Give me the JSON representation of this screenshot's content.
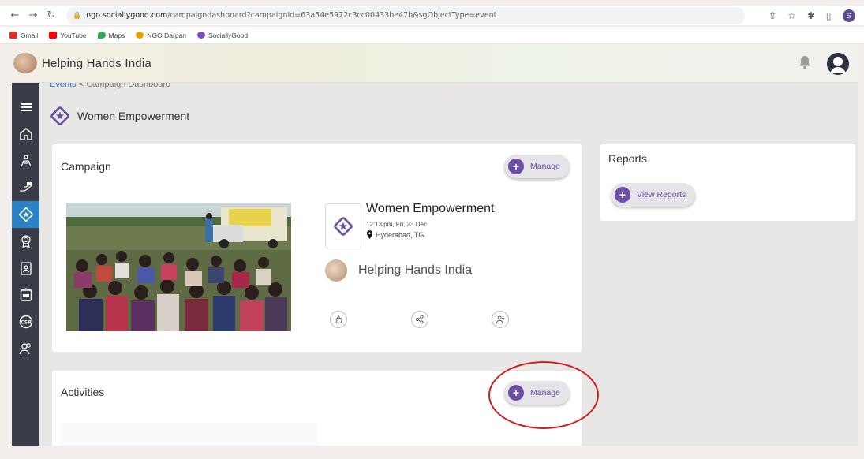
{
  "browser": {
    "url_host": "ngo.sociallygood.com",
    "url_rest": "/campaigndashboard?campaignId=63a54e5972c3cc00433be47b&sgObjectType=event",
    "profile_initial": "S",
    "bookmarks": [
      {
        "label": "Gmail",
        "color": "#d93025"
      },
      {
        "label": "YouTube",
        "color": "#ff0000"
      },
      {
        "label": "Maps",
        "color": "#34a853"
      },
      {
        "label": "NGO Darpan",
        "color": "#e8a200"
      },
      {
        "label": "SociallyGood",
        "color": "#7b4fc9"
      }
    ]
  },
  "header": {
    "org_name": "Helping Hands India"
  },
  "breadcrumb": {
    "link": "Events",
    "separator": "<",
    "current": "Campaign Dashboard"
  },
  "page": {
    "title": "Women Empowerment"
  },
  "campaign_card": {
    "title": "Campaign",
    "manage_label": "Manage",
    "event_name": "Women Empowerment",
    "event_time": "12:13 pm, Fri, 23 Dec",
    "event_location": "Hyderabad, TG",
    "organizer": "Helping Hands India"
  },
  "reports_card": {
    "title": "Reports",
    "view_label": "View Reports"
  },
  "activities_card": {
    "title": "Activities",
    "manage_label": "Manage"
  },
  "colors": {
    "accent": "#6a4fa3",
    "sidebar_bg": "#3a3d48",
    "sidebar_active": "#2a82c7",
    "annotation": "#d01c1c"
  }
}
